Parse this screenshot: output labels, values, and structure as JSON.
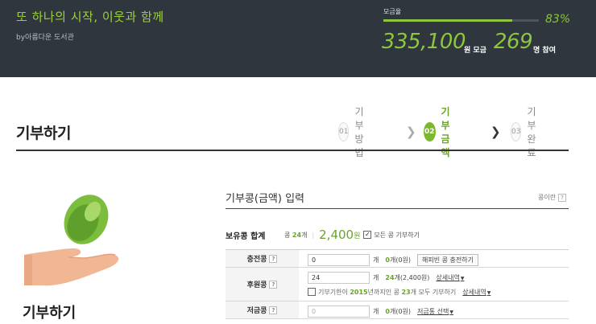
{
  "banner": {
    "title": "또 하나의 시작, 이웃과 함께",
    "org": "by아름다운 도서관",
    "progress_label": "모금율",
    "progress_percent": 83,
    "progress_percent_text": "83%",
    "amount": "335,100",
    "amount_unit": "원 모금",
    "participants": "269",
    "participants_unit": "명 참여"
  },
  "page": {
    "title": "기부하기"
  },
  "steps": [
    {
      "num": "01",
      "label": "기부방법",
      "active": false
    },
    {
      "num": "02",
      "label": "기부금액",
      "active": true
    },
    {
      "num": "03",
      "label": "기부완료",
      "active": false
    }
  ],
  "side": {
    "title": "기부하기"
  },
  "form": {
    "section_title": "기부콩(금액) 입력",
    "help_label": "콩이란",
    "help_icon": "?",
    "holding": {
      "label": "보유콩 합계",
      "prefix": "콩",
      "count": "24",
      "count_unit": "개",
      "amount": "2,400",
      "amount_unit": "원",
      "donate_all_label": "모든 콩 기부하기",
      "donate_all_checked": true
    },
    "rows": {
      "charge": {
        "label": "충전콩",
        "input_value": "0",
        "unit": "개",
        "summary_count": "0",
        "summary_count_unit": "개",
        "summary_amount": "(0원)",
        "button": "해피빈 콩 충전하기"
      },
      "support": {
        "label": "후원콩",
        "input_value": "24",
        "unit": "개",
        "summary_count": "24",
        "summary_count_unit": "개",
        "summary_amount": "(2,400원)",
        "detail_link": "상세내역",
        "note_pre": "기부기한이",
        "note_year": "2015",
        "note_mid": "년까지인 콩",
        "note_count": "23",
        "note_post": "개 모두 기부하기",
        "note_link": "상세내역",
        "note_checked": false
      },
      "savings": {
        "label": "저금콩",
        "input_placeholder": "0",
        "unit": "개",
        "summary_count": "0",
        "summary_count_unit": "개",
        "summary_amount": "(0원)",
        "select_link": "저금통 선택"
      }
    }
  },
  "colors": {
    "banner_bg": "#2f363d",
    "accent_green": "#8dc63f",
    "active_step": "#7cb82f"
  }
}
